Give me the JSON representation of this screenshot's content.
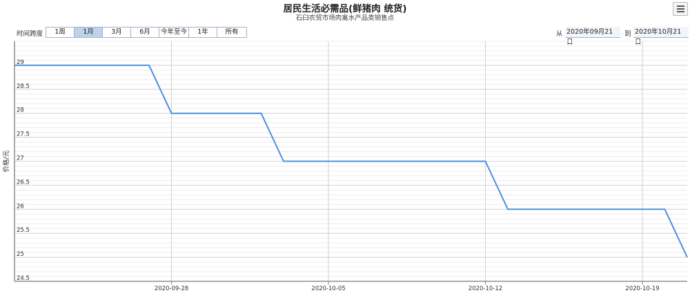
{
  "header": {
    "title": "居民生活必需品(鲜猪肉 统货)",
    "subtitle": "石臼农贸市场肉禽水产品类销售点",
    "menu_icon": "hamburger-menu-icon"
  },
  "range_selector": {
    "label": "时间跨度",
    "buttons": [
      {
        "label": "1周",
        "active": false
      },
      {
        "label": "1月",
        "active": true
      },
      {
        "label": "3月",
        "active": false
      },
      {
        "label": "6月",
        "active": false
      },
      {
        "label": "今年至今",
        "active": false
      },
      {
        "label": "1年",
        "active": false
      },
      {
        "label": "所有",
        "active": false
      }
    ],
    "from_label": "从",
    "from_value": "2020年09月21日",
    "to_label": "到",
    "to_value": "2020年10月21日"
  },
  "chart_data": {
    "type": "line",
    "title": "居民生活必需品(鲜猪肉 统货)",
    "subtitle": "石臼农贸市场肉禽水产品类销售点",
    "ylabel": "价格/元",
    "xlabel": "",
    "ylim": [
      24.5,
      29.5
    ],
    "yticks": [
      24.5,
      25,
      25.5,
      26,
      26.5,
      27,
      27.5,
      28,
      28.5,
      29
    ],
    "xlim": [
      "2020-09-21",
      "2020-10-21"
    ],
    "xticks": [
      "2020-09-28",
      "2020-10-05",
      "2020-10-12",
      "2020-10-19"
    ],
    "grid": true,
    "series": [
      {
        "color": "#4a90e2",
        "points": [
          {
            "x": "2020-09-21",
            "y": 29
          },
          {
            "x": "2020-09-27",
            "y": 29
          },
          {
            "x": "2020-09-28",
            "y": 28
          },
          {
            "x": "2020-10-02",
            "y": 28
          },
          {
            "x": "2020-10-03",
            "y": 27
          },
          {
            "x": "2020-10-12",
            "y": 27
          },
          {
            "x": "2020-10-13",
            "y": 26
          },
          {
            "x": "2020-10-20",
            "y": 26
          },
          {
            "x": "2020-10-21",
            "y": 25
          }
        ]
      }
    ]
  }
}
